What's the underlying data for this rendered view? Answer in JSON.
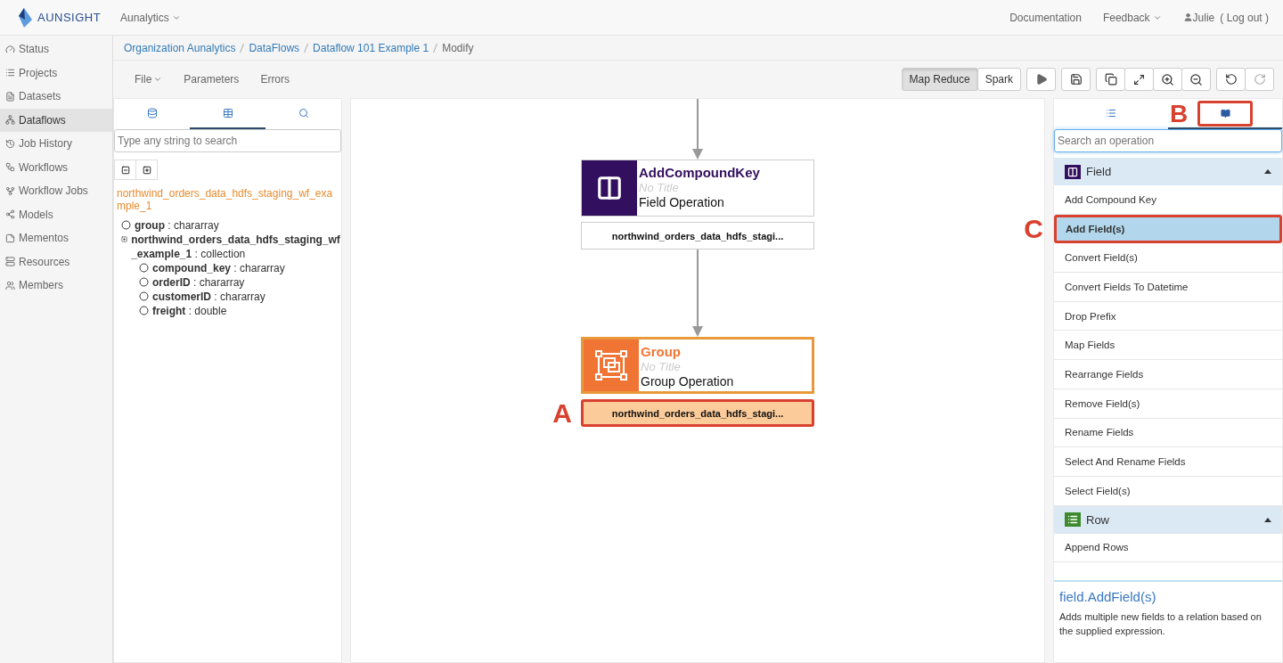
{
  "header": {
    "logo": "AUNSIGHT",
    "org_menu": "Aunalytics",
    "links": [
      {
        "label": "Documentation",
        "dropdown": false
      },
      {
        "label": "Feedback",
        "dropdown": true
      }
    ],
    "user": "Julie",
    "logout": "( Log out )"
  },
  "sidebar": {
    "items": [
      {
        "label": "Status",
        "selected": false
      },
      {
        "label": "Projects",
        "selected": false
      },
      {
        "label": "Datasets",
        "selected": false
      },
      {
        "label": "Dataflows",
        "selected": true
      },
      {
        "label": "Job History",
        "selected": false
      },
      {
        "label": "Workflows",
        "selected": false
      },
      {
        "label": "Workflow Jobs",
        "selected": false
      },
      {
        "label": "Models",
        "selected": false
      },
      {
        "label": "Mementos",
        "selected": false
      },
      {
        "label": "Resources",
        "selected": false
      },
      {
        "label": "Members",
        "selected": false
      }
    ]
  },
  "breadcrumb": [
    "Organization Aunalytics",
    "DataFlows",
    "Dataflow 101 Example 1",
    "Modify"
  ],
  "menu": [
    {
      "label": "File",
      "dropdown": true
    },
    {
      "label": "Parameters",
      "dropdown": false
    },
    {
      "label": "Errors",
      "dropdown": false
    }
  ],
  "engines": [
    {
      "label": "Map Reduce",
      "selected": true
    },
    {
      "label": "Spark",
      "selected": false
    }
  ],
  "schema_panel": {
    "tabs": [
      {
        "selected": false
      },
      {
        "selected": true
      },
      {
        "selected": false
      }
    ],
    "search": {
      "placeholder": "Type any string to search"
    },
    "relation": "northwind_orders_data_hdfs_staging_wf_example_1",
    "fields": [
      {
        "kind": "leaf",
        "text": "**group** : chararray"
      },
      {
        "kind": "collection",
        "text": "**northwind_orders_data_hdfs_staging_wf_example_1** : collection",
        "children": [
          {
            "kind": "leaf",
            "text": "**compound_key** : chararray"
          },
          {
            "kind": "leaf",
            "text": "**orderID** : chararray"
          },
          {
            "kind": "leaf",
            "text": "**customerID** : chararray"
          },
          {
            "kind": "leaf",
            "text": "**freight** : double"
          }
        ]
      }
    ]
  },
  "canvas": {
    "nodes": [
      {
        "kind": "field",
        "name": "AddCompoundKey",
        "title": "No Title",
        "operation": "Field Operation",
        "port": "northwind_orders_data_hdfs_stagi...",
        "selected": false
      },
      {
        "kind": "group",
        "name": "Group",
        "title": "No Title",
        "operation": "Group Operation",
        "port": "northwind_orders_data_hdfs_stagi...",
        "selected": true,
        "callout": "A"
      }
    ]
  },
  "operations_panel": {
    "tabs": [
      {
        "selected": false
      },
      {
        "selected": true,
        "callout": "B"
      }
    ],
    "search": {
      "placeholder": "Search an operation"
    },
    "categories": [
      {
        "kind": "field",
        "name": "Field",
        "expanded": true,
        "items": [
          {
            "label": "Add Compound Key",
            "selected": false
          },
          {
            "label": "Add Field(s)",
            "selected": true,
            "callout": "C"
          },
          {
            "label": "Convert Field(s)",
            "selected": false
          },
          {
            "label": "Convert Fields To Datetime",
            "selected": false
          },
          {
            "label": "Drop Prefix",
            "selected": false
          },
          {
            "label": "Map Fields",
            "selected": false
          },
          {
            "label": "Rearrange Fields",
            "selected": false
          },
          {
            "label": "Remove Field(s)",
            "selected": false
          },
          {
            "label": "Rename Fields",
            "selected": false
          },
          {
            "label": "Select And Rename Fields",
            "selected": false
          },
          {
            "label": "Select Field(s)",
            "selected": false
          }
        ]
      },
      {
        "kind": "row",
        "name": "Row",
        "expanded": true,
        "items": [
          {
            "label": "Append Rows",
            "selected": false
          }
        ]
      }
    ],
    "description": {
      "title": "field.AddField(s)",
      "text": "Adds multiple new fields to a relation based on the supplied expression."
    }
  }
}
